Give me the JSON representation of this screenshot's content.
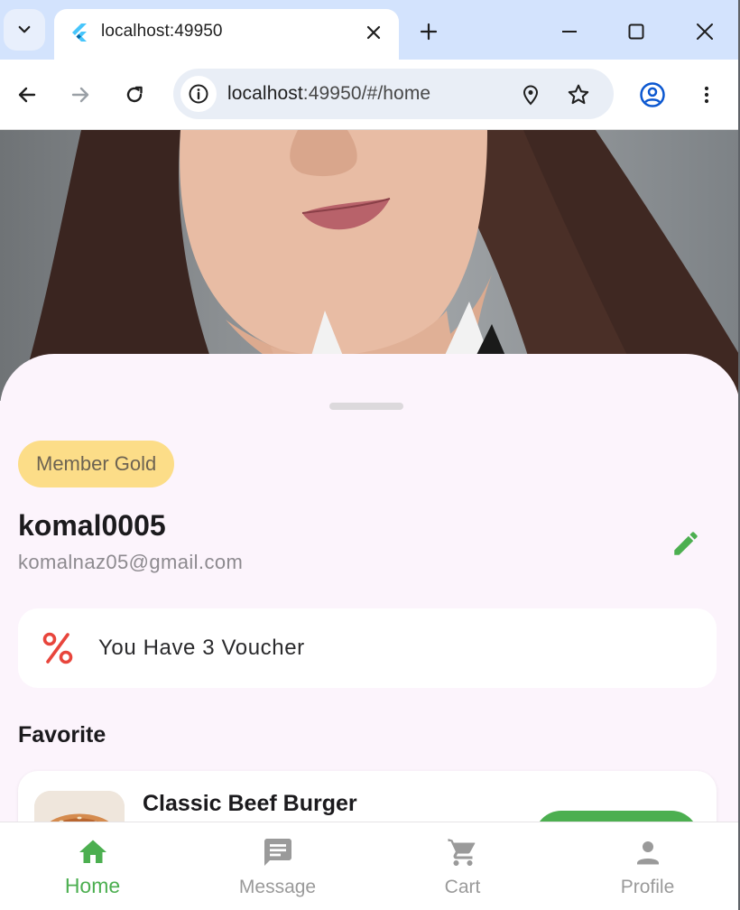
{
  "browser": {
    "tab_title": "localhost:49950",
    "url_host": "localhost",
    "url_path": ":49950/#/home",
    "icons": {
      "tab_menu": "chevron-down-icon",
      "favicon": "flutter-logo-icon",
      "tab_close": "close-icon",
      "new_tab": "plus-icon",
      "minimize": "minimize-icon",
      "maximize": "maximize-icon",
      "close_window": "close-window-icon",
      "back": "back-arrow-icon",
      "forward": "forward-arrow-icon",
      "reload": "reload-icon",
      "site_info": "info-icon",
      "location": "location-pin-icon",
      "bookmark": "star-icon",
      "profile": "account-circle-icon",
      "menu": "more-vert-icon"
    }
  },
  "profile": {
    "member_badge": "Member Gold",
    "username": "komal0005",
    "email": "komalnaz05@gmail.com",
    "edit_icon": "pencil-icon"
  },
  "voucher": {
    "icon": "percent-icon",
    "text": "You Have 3 Voucher"
  },
  "favorites": {
    "title": "Favorite",
    "items": [
      {
        "name": "Classic Beef Burger",
        "thumbnail": "burger-image"
      }
    ]
  },
  "bottom_nav": {
    "items": [
      {
        "label": "Home",
        "icon": "home-icon",
        "active": true
      },
      {
        "label": "Message",
        "icon": "message-icon",
        "active": false
      },
      {
        "label": "Cart",
        "icon": "cart-icon",
        "active": false
      },
      {
        "label": "Profile",
        "icon": "person-icon",
        "active": false
      }
    ]
  },
  "colors": {
    "accent_green": "#4caf50",
    "badge_gold": "#fcdd88",
    "voucher_red": "#e8453c",
    "sheet_background": "#fcf4fc",
    "chrome_tab_strip": "#d3e3fd"
  }
}
